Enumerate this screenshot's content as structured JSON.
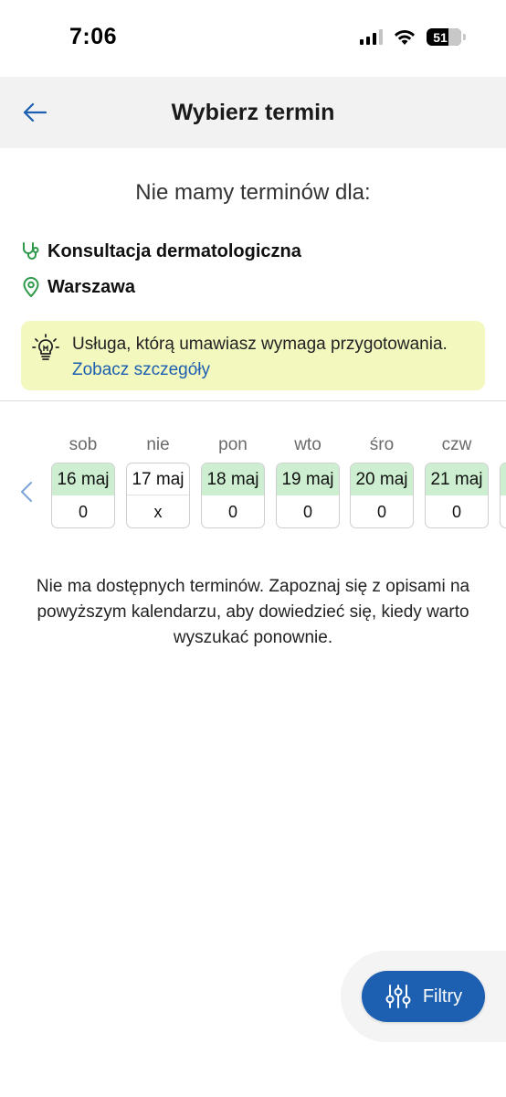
{
  "status_bar": {
    "time": "7:06",
    "battery": "51"
  },
  "header": {
    "title": "Wybierz termin"
  },
  "subtitle": "Nie mamy terminów dla:",
  "service": {
    "name": "Konsultacja dermatologiczna"
  },
  "location": {
    "city": "Warszawa"
  },
  "notice": {
    "text": "Usługa, którą umawiasz wymaga przygotowania.",
    "link": "Zobacz szczegóły"
  },
  "calendar": {
    "days": [
      {
        "weekday": "sob",
        "date": "16 maj",
        "count": "0",
        "available": true
      },
      {
        "weekday": "nie",
        "date": "17 maj",
        "count": "x",
        "available": false
      },
      {
        "weekday": "pon",
        "date": "18 maj",
        "count": "0",
        "available": true
      },
      {
        "weekday": "wto",
        "date": "19 maj",
        "count": "0",
        "available": true
      },
      {
        "weekday": "śro",
        "date": "20 maj",
        "count": "0",
        "available": true
      },
      {
        "weekday": "czw",
        "date": "21 maj",
        "count": "0",
        "available": true
      }
    ]
  },
  "empty_message": "Nie ma dostępnych terminów. Zapoznaj się z opisami na powyższym kalendarzu, aby dowiedzieć się, kiedy warto wyszukać ponownie.",
  "filters_button": {
    "label": "Filtry"
  },
  "colors": {
    "accent": "#1d5fb0",
    "available": "#cdeed0",
    "notice_bg": "#f3f8bf",
    "icon_green": "#2e9a4a"
  }
}
